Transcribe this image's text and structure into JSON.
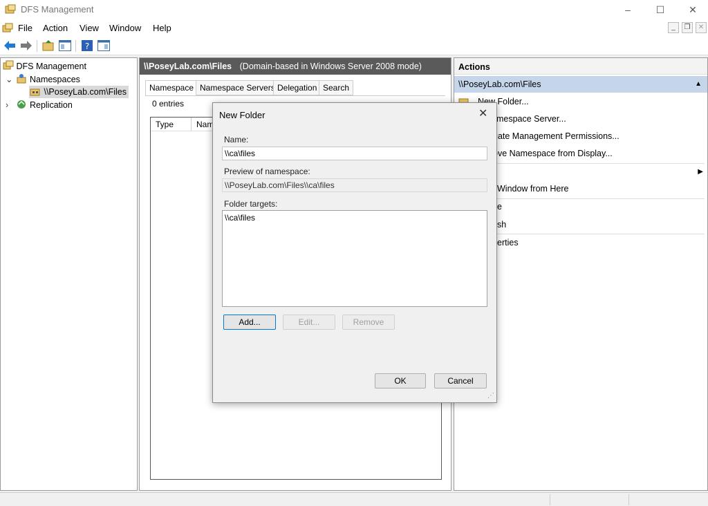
{
  "window": {
    "title": "DFS Management",
    "controls": [
      "–",
      "☐",
      "✕"
    ]
  },
  "menu": {
    "items": [
      "File",
      "Action",
      "View",
      "Window",
      "Help"
    ]
  },
  "tree": {
    "root": "DFS Management",
    "namespaces": "Namespaces",
    "namespace_item": "\\\\PoseyLab.com\\Files",
    "replication": "Replication"
  },
  "center": {
    "header_title": "\\\\PoseyLab.com\\Files",
    "header_mode": "(Domain-based in Windows Server 2008 mode)",
    "tabs": [
      "Namespace",
      "Namespace Servers",
      "Delegation",
      "Search"
    ],
    "entries": "0 entries",
    "columns": [
      "Type",
      "Nam"
    ]
  },
  "actions": {
    "header": "Actions",
    "section": "\\\\PoseyLab.com\\Files",
    "items": [
      "New Folder...",
      "Namespace Server...",
      "gate Management Permissions...",
      "ove Namespace from Display...",
      "",
      "Window from Here",
      "e",
      "sh",
      "erties"
    ]
  },
  "dialog": {
    "title": "New Folder",
    "name_label": "Name:",
    "name_value": "\\\\ca\\files",
    "preview_label": "Preview of namespace:",
    "preview_value": "\\\\PoseyLab.com\\Files\\\\ca\\files",
    "targets_label": "Folder targets:",
    "targets": [
      "\\\\ca\\files"
    ],
    "add_label": "Add...",
    "edit_label": "Edit...",
    "remove_label": "Remove",
    "ok_label": "OK",
    "cancel_label": "Cancel"
  },
  "colors": {
    "accent": "#0078d7",
    "header_dark": "#5a5a5a",
    "selection": "#c5d6ea"
  }
}
